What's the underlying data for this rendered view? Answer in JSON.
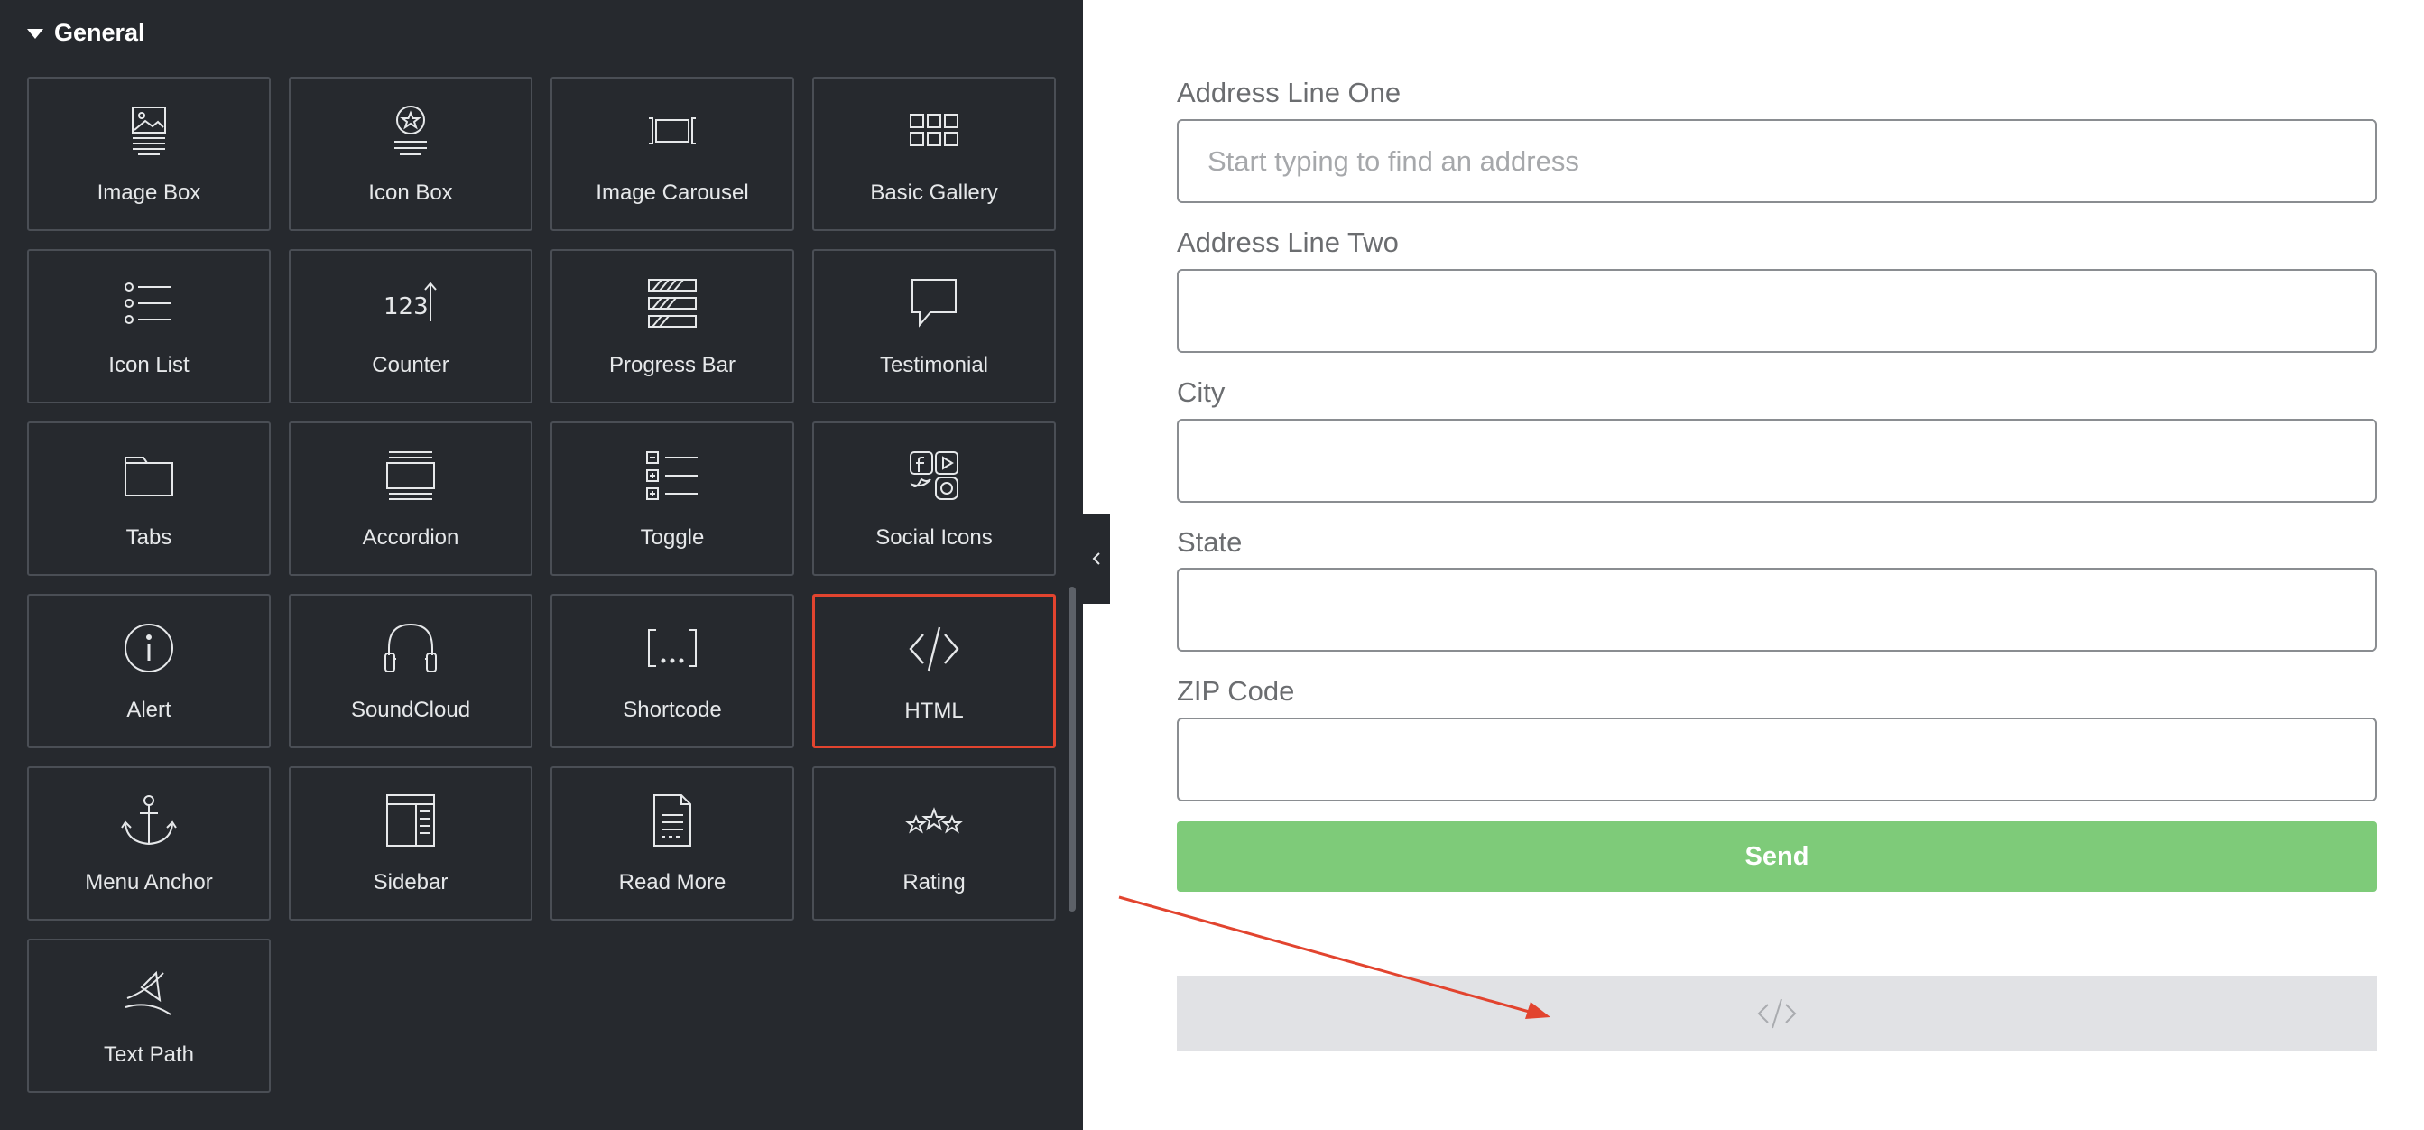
{
  "panel": {
    "section_title": "General",
    "widgets": [
      {
        "label": "Image Box",
        "icon": "image-box-icon"
      },
      {
        "label": "Icon Box",
        "icon": "icon-box-icon"
      },
      {
        "label": "Image Carousel",
        "icon": "image-carousel-icon"
      },
      {
        "label": "Basic Gallery",
        "icon": "basic-gallery-icon"
      },
      {
        "label": "Icon List",
        "icon": "icon-list-icon"
      },
      {
        "label": "Counter",
        "icon": "counter-icon"
      },
      {
        "label": "Progress Bar",
        "icon": "progress-bar-icon"
      },
      {
        "label": "Testimonial",
        "icon": "testimonial-icon"
      },
      {
        "label": "Tabs",
        "icon": "tabs-icon"
      },
      {
        "label": "Accordion",
        "icon": "accordion-icon"
      },
      {
        "label": "Toggle",
        "icon": "toggle-icon"
      },
      {
        "label": "Social Icons",
        "icon": "social-icons-icon"
      },
      {
        "label": "Alert",
        "icon": "alert-icon"
      },
      {
        "label": "SoundCloud",
        "icon": "soundcloud-icon"
      },
      {
        "label": "Shortcode",
        "icon": "shortcode-icon"
      },
      {
        "label": "HTML",
        "icon": "html-code-icon"
      },
      {
        "label": "Menu Anchor",
        "icon": "anchor-icon"
      },
      {
        "label": "Sidebar",
        "icon": "sidebar-icon"
      },
      {
        "label": "Read More",
        "icon": "read-more-icon"
      },
      {
        "label": "Rating",
        "icon": "rating-stars-icon"
      },
      {
        "label": "Text Path",
        "icon": "text-path-icon"
      }
    ],
    "counter_glyph": "123"
  },
  "form": {
    "address_line_one": {
      "label": "Address Line One",
      "placeholder": "Start typing to find an address",
      "value": ""
    },
    "address_line_two": {
      "label": "Address Line Two",
      "placeholder": "",
      "value": ""
    },
    "city": {
      "label": "City",
      "placeholder": "",
      "value": ""
    },
    "state": {
      "label": "State",
      "placeholder": "",
      "value": ""
    },
    "zip_code": {
      "label": "ZIP Code",
      "placeholder": "",
      "value": ""
    },
    "send_label": "Send"
  },
  "colors": {
    "panel_bg": "#26292e",
    "selected_border": "#e2442f",
    "send_green": "#7ecb79",
    "arrow_red": "#e2442f",
    "html_placeholder_bg": "#e1e2e5"
  }
}
